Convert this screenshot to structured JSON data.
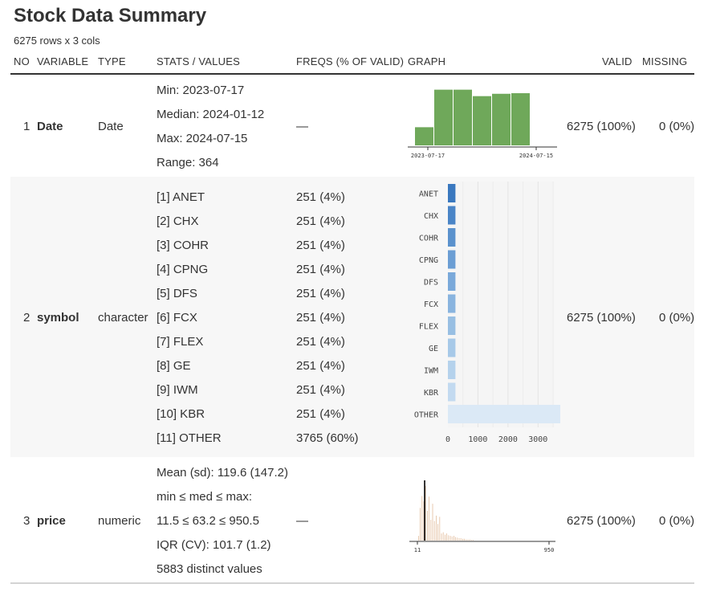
{
  "title": "Stock Data Summary",
  "subtitle": "6275 rows x 3 cols",
  "columns": {
    "no": "NO",
    "variable": "VARIABLE",
    "type": "TYPE",
    "stats": "STATS / VALUES",
    "freqs": "FREQS (% OF VALID)",
    "graph": "GRAPH",
    "valid": "VALID",
    "missing": "MISSING"
  },
  "rows": [
    {
      "no": "1",
      "variable": "Date",
      "type": "Date",
      "stats": [
        "Min: 2023-07-17",
        "Median: 2024-01-12",
        "Max: 2024-07-15",
        "Range: 364"
      ],
      "freqs": "—",
      "valid": "6275 (100%)",
      "missing": "0 (0%)"
    },
    {
      "no": "2",
      "variable": "symbol",
      "type": "character",
      "stats": [
        "[1] ANET",
        "[2] CHX",
        "[3] COHR",
        "[4] CPNG",
        "[5] DFS",
        "[6] FCX",
        "[7] FLEX",
        "[8] GE",
        "[9] IWM",
        "[10] KBR",
        "[11] OTHER"
      ],
      "freqs": [
        "251 (4%)",
        "251 (4%)",
        "251 (4%)",
        "251 (4%)",
        "251 (4%)",
        "251 (4%)",
        "251 (4%)",
        "251 (4%)",
        "251 (4%)",
        "251 (4%)",
        "3765 (60%)"
      ],
      "valid": "6275 (100%)",
      "missing": "0 (0%)"
    },
    {
      "no": "3",
      "variable": "price",
      "type": "numeric",
      "stats": [
        "Mean (sd): 119.6 (147.2)",
        "min ≤ med ≤ max:",
        "11.5 ≤ 63.2 ≤ 950.5",
        "IQR (CV): 101.7 (1.2)",
        "5883 distinct values"
      ],
      "freqs": "—",
      "valid": "6275 (100%)",
      "missing": "0 (0%)"
    }
  ],
  "chart_data": [
    {
      "type": "bar",
      "categories": [
        "1",
        "2",
        "3",
        "4",
        "5",
        "6"
      ],
      "values": [
        0.31,
        0.95,
        0.95,
        0.84,
        0.88,
        0.89
      ],
      "xticks": [
        "2023-07-17",
        "2024-07-15"
      ],
      "color": "#6fa85a"
    },
    {
      "type": "bar",
      "orientation": "horizontal",
      "categories": [
        "ANET",
        "CHX",
        "COHR",
        "CPNG",
        "DFS",
        "FCX",
        "FLEX",
        "GE",
        "IWM",
        "KBR",
        "OTHER"
      ],
      "values": [
        251,
        251,
        251,
        251,
        251,
        251,
        251,
        251,
        251,
        251,
        3765
      ],
      "xticks": [
        "0",
        "1000",
        "2000",
        "3000"
      ],
      "xlim": [
        0,
        3900
      ],
      "colors": [
        "#3a78bf",
        "#4a85c7",
        "#5b92cd",
        "#6b9ed4",
        "#7aa9da",
        "#89b4df",
        "#98bfe3",
        "#a7c9e8",
        "#b5d2ec",
        "#c3daf0",
        "#dbe9f6"
      ]
    },
    {
      "type": "histogram",
      "values": [
        0.08,
        0.55,
        0.75,
        0.66,
        0.92,
        0.5,
        0.74,
        0.35,
        0.62,
        0.33,
        0.42,
        0.28,
        0.4,
        0.12,
        0.14,
        0.1,
        0.12,
        0.09,
        0.08,
        0.07,
        0.08,
        0.06,
        0.05,
        0.04,
        0.04,
        0.03,
        0.03,
        0.02,
        0.02,
        0.02,
        0.01,
        0.01
      ],
      "median": 63.2,
      "xlim": [
        11.5,
        950.5
      ],
      "xticks": [
        "11",
        "950"
      ],
      "color": "#d9a57a",
      "median_color": "#000000"
    }
  ]
}
